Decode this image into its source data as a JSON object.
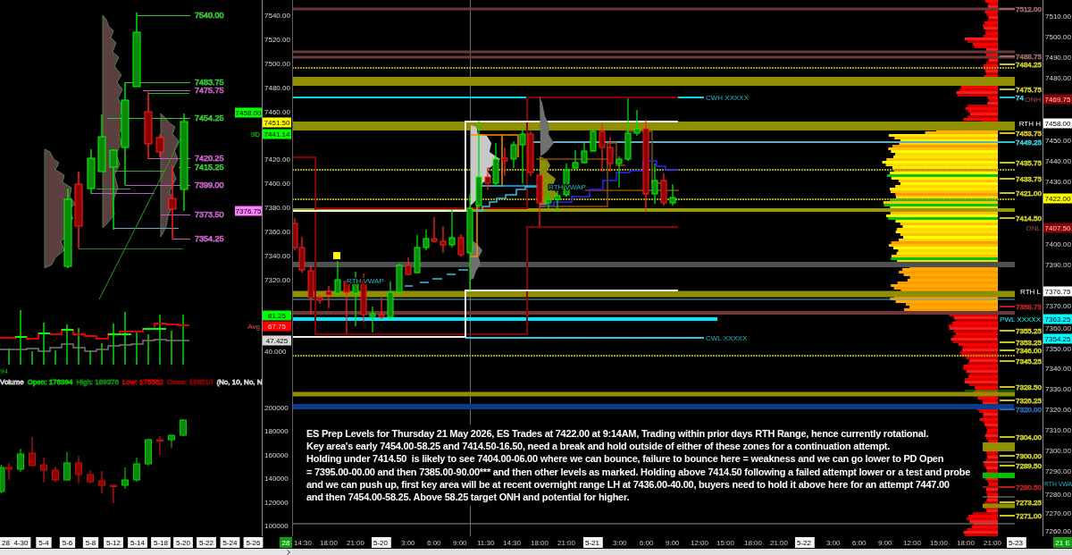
{
  "daily_chart": {
    "level_labels": [
      {
        "text": "7540.00",
        "color": "#33c433"
      },
      {
        "text": "7483.75",
        "color": "#33c433"
      },
      {
        "text": "7475.75",
        "color": "#c25fc2"
      },
      {
        "text": "7454.25",
        "color": "#33c433"
      },
      {
        "text": "7420.25",
        "color": "#c25fc2"
      },
      {
        "text": "7415.25",
        "color": "#33c433"
      },
      {
        "text": "7399.00",
        "color": "#c25fc2"
      },
      {
        "text": "7373.50",
        "color": "#c25fc2"
      },
      {
        "text": "7354.25",
        "color": "#c25fc2"
      }
    ],
    "price_axis": [
      "7540.00",
      "7520.00",
      "7500.00",
      "7480.00",
      "7460.00",
      "7420.00",
      "7400.00",
      "7380.00",
      "7360.00",
      "7340.00",
      "7320.00"
    ],
    "price_tags": [
      {
        "text": "7458.00",
        "color": "#00ff00"
      },
      {
        "text": "7451.50",
        "color": "#ffff00"
      },
      {
        "prefix": "9D",
        "text": "7441.14",
        "color": "#00ff00"
      },
      {
        "text": "7376.75",
        "color": "#ff80ff"
      }
    ]
  },
  "indicator": {
    "cut_value": "94",
    "tags": [
      {
        "text": "81.25",
        "color": "#00ff00"
      },
      {
        "prefix": "Avg",
        "text": "67.75",
        "color": "#ff0000"
      },
      {
        "text": "47.425",
        "color": "#d8d8d8"
      }
    ],
    "axis": [
      "40.000"
    ]
  },
  "volume_chart": {
    "legend": [
      {
        "text": "Volume",
        "color": "#cfcfcf"
      },
      {
        "text": "Open: 176394",
        "color": "#00c800"
      },
      {
        "text": "High: 189376",
        "color": "#0a8a0a"
      },
      {
        "text": "Low: 175562",
        "color": "#d00000"
      },
      {
        "text": "Close: 188510",
        "color": "#8a0000"
      },
      {
        "text": "(No, 10, No, N",
        "color": "#cfcfcf"
      }
    ],
    "axis": [
      "200000",
      "180000",
      "160000",
      "140000",
      "120000",
      "100000"
    ]
  },
  "daily_dates": [
    "28",
    "4-30",
    "5-4",
    "5-6",
    "5-8",
    "5-12",
    "5-14",
    "5-18",
    "5-20",
    "5-22",
    "5-24",
    "5-26"
  ],
  "intraday_chart": {
    "annotations": [
      "CWH XXXXX",
      "RTH VWAP",
      "RTH VWAP",
      "CWL XXXXX"
    ],
    "level_labels": [
      {
        "text": "7512.00",
        "color": "#9a6262"
      },
      {
        "text": "7488.75",
        "color": "#9a6262"
      },
      {
        "text": "7484.25",
        "color": "#c4c42a"
      },
      {
        "text": "7475.75",
        "color": "#c4c42a"
      },
      {
        "text": "74",
        "color": "#30c0d0"
      },
      {
        "text": "7453.75",
        "color": "#c4c42a"
      },
      {
        "text": "7449.25",
        "color": "#30c0d0"
      },
      {
        "text": "7435.75",
        "color": "#c4c42a"
      },
      {
        "text": "7433.75",
        "color": "#c4c42a"
      },
      {
        "text": "7421.00",
        "color": "#c4c42a"
      },
      {
        "text": "7414.50",
        "color": "#c4c42a"
      },
      {
        "text": "7368.75",
        "color": "#b02020"
      },
      {
        "text": "7355.25",
        "color": "#c4c42a"
      },
      {
        "text": "7353.25",
        "color": "#c4c42a"
      },
      {
        "text": "7346.00",
        "color": "#c4c42a"
      },
      {
        "text": "7345.25",
        "color": "#c4c42a"
      },
      {
        "text": "7328.50",
        "color": "#c4c42a"
      },
      {
        "text": "7326.25",
        "color": "#c4c42a"
      },
      {
        "text": "7320.00",
        "color": "#2a64b0"
      },
      {
        "text": "7304.00",
        "color": "#c4c42a"
      },
      {
        "text": "7300.00",
        "color": "#c4c42a"
      },
      {
        "text": "7289.50",
        "color": "#c4c42a"
      },
      {
        "text": "7280.50",
        "color": "#b02020"
      },
      {
        "text": "7273.25",
        "color": "#c4c42a"
      },
      {
        "text": "7271.00",
        "color": "#c4c42a"
      }
    ],
    "price_tags": [
      {
        "prefix": "ONH",
        "text": "7469.75",
        "color": "#8b0000"
      },
      {
        "prefix": "RTH H",
        "text": "7458.00",
        "color": "#ffffff"
      },
      {
        "text": "7422.00",
        "color": "#ffff00"
      },
      {
        "prefix": "ONL",
        "text": "7407.50",
        "color": "#8b0000"
      },
      {
        "prefix": "RTH L",
        "text": "7376.75",
        "color": "#ffffff"
      },
      {
        "prefix": "PWL XXXXX",
        "text": "7363.25",
        "color": "#00ffff"
      },
      {
        "text": "7354.25",
        "color": "#00ffff"
      }
    ],
    "price_axis": [
      "7510.00",
      "7500.00",
      "7490.00",
      "7480.00",
      "7450.00",
      "7440.00",
      "7430.00",
      "7400.00",
      "7390.00",
      "7370.00",
      "7360.00",
      "7350.00",
      "7340.00",
      "7330.00",
      "7320.00",
      "7310.00",
      "7300.00",
      "7290.00",
      "7280.00",
      "7270.00",
      "7260.00"
    ],
    "cut_label": "RTH VWA",
    "note": "ES Prep Levels for Thursday 21 May 2026, ES Trades at 7422.00 at 9:14AM, Trading within prior days RTH Range, hence currently rotational.\nKey area's early 7454.00-58.25 and 7414.50-16.50, need a break and hold outside of either of these zones for a continuation attempt.\nHolding under 7414.50  is likely to see 7404.00-06.00 where we can bounce, failure to bounce here = weakness and we can go lower to PD Open\n= 7395.00-00.00 and then 7385.00-90.00*** and then other levels as marked. Holding above 7414.50 following a failed attempt lower or a test and probe\nand we can push up, first key area will be at recent overnight range LH at 7436.00-40.00, buyers need to hold it above here for an attempt 7447.00\nand then 7454.00-58.25. Above 58.25 target ONH and potential for higher."
  },
  "time_axis": {
    "start_tag": "28",
    "labels": [
      {
        "text": "14:30",
        "kind": "time"
      },
      {
        "text": "18:00",
        "kind": "time"
      },
      {
        "text": "21:00",
        "kind": "time"
      },
      {
        "text": "5-20",
        "kind": "date"
      },
      {
        "text": "3:00",
        "kind": "time"
      },
      {
        "text": "6:00",
        "kind": "time"
      },
      {
        "text": "9:00",
        "kind": "time"
      },
      {
        "text": "11:30",
        "kind": "time"
      },
      {
        "text": "14:30",
        "kind": "time"
      },
      {
        "text": "18:00",
        "kind": "time"
      },
      {
        "text": "21:00",
        "kind": "time"
      },
      {
        "text": "5-21",
        "kind": "date"
      },
      {
        "text": "3:00",
        "kind": "time"
      },
      {
        "text": "6:00",
        "kind": "time"
      },
      {
        "text": "9:00",
        "kind": "time"
      },
      {
        "text": "12:00",
        "kind": "time"
      },
      {
        "text": "15:00",
        "kind": "time"
      },
      {
        "text": "18:00",
        "kind": "time"
      },
      {
        "text": "21:00",
        "kind": "time"
      },
      {
        "text": "5-22",
        "kind": "date"
      },
      {
        "text": "3:00",
        "kind": "time"
      },
      {
        "text": "6:00",
        "kind": "time"
      },
      {
        "text": "9:00",
        "kind": "time"
      },
      {
        "text": "12:00",
        "kind": "time"
      },
      {
        "text": "15:00",
        "kind": "time"
      },
      {
        "text": "18:00",
        "kind": "time"
      },
      {
        "text": "21:00",
        "kind": "time"
      },
      {
        "text": "5-23",
        "kind": "date"
      }
    ],
    "end_tag": "21 E"
  }
}
